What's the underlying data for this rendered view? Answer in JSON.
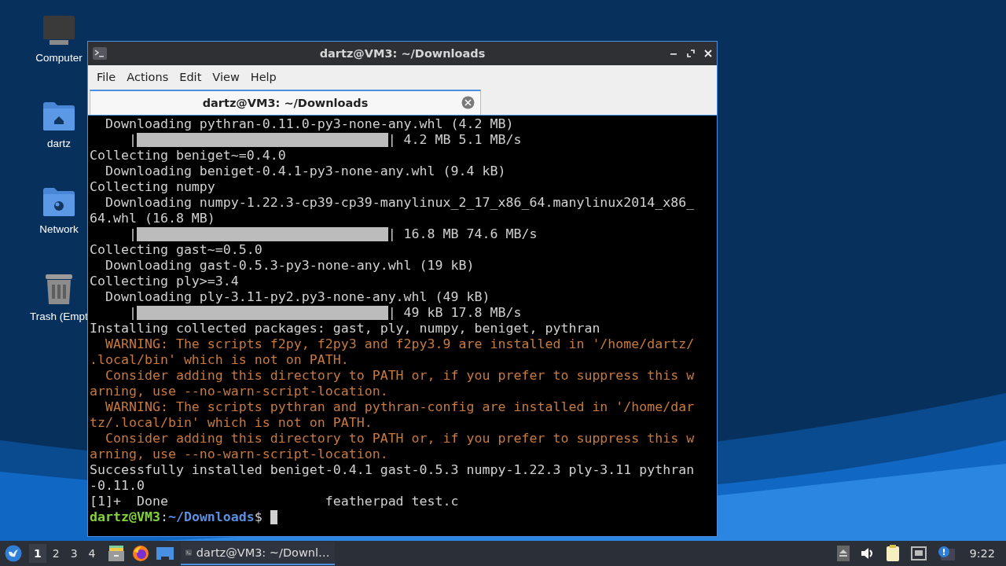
{
  "desktop": {
    "icons": [
      {
        "kind": "computer",
        "label": "Computer"
      },
      {
        "kind": "home",
        "label": "dartz"
      },
      {
        "kind": "network",
        "label": "Network"
      },
      {
        "kind": "trash",
        "label": "Trash (Empt"
      }
    ]
  },
  "window": {
    "title": "dartz@VM3: ~/Downloads",
    "menu": [
      "File",
      "Actions",
      "Edit",
      "View",
      "Help"
    ],
    "tabs": [
      {
        "label": "dartz@VM3: ~/Downloads",
        "selected": true
      }
    ],
    "terminal": {
      "lines": [
        {
          "kind": "normal",
          "text": "  Downloading pythran-0.11.0-py3-none-any.whl (4.2 MB)"
        },
        {
          "kind": "progress",
          "lead": "     |",
          "tail": "| 4.2 MB 5.1 MB/s",
          "level": 1
        },
        {
          "kind": "normal",
          "text": "Collecting beniget~=0.4.0"
        },
        {
          "kind": "normal",
          "text": "  Downloading beniget-0.4.1-py3-none-any.whl (9.4 kB)"
        },
        {
          "kind": "normal",
          "text": "Collecting numpy"
        },
        {
          "kind": "normal",
          "text": "  Downloading numpy-1.22.3-cp39-cp39-manylinux_2_17_x86_64.manylinux2014_x86_"
        },
        {
          "kind": "normal",
          "text": "64.whl (16.8 MB)"
        },
        {
          "kind": "progress",
          "lead": "     |",
          "tail": "| 16.8 MB 74.6 MB/s",
          "level": 1
        },
        {
          "kind": "normal",
          "text": "Collecting gast~=0.5.0"
        },
        {
          "kind": "normal",
          "text": "  Downloading gast-0.5.3-py3-none-any.whl (19 kB)"
        },
        {
          "kind": "normal",
          "text": "Collecting ply>=3.4"
        },
        {
          "kind": "normal",
          "text": "  Downloading ply-3.11-py2.py3-none-any.whl (49 kB)"
        },
        {
          "kind": "progress",
          "lead": "     |",
          "tail": "| 49 kB 17.8 MB/s",
          "level": 1
        },
        {
          "kind": "normal",
          "text": "Installing collected packages: gast, ply, numpy, beniget, pythran"
        },
        {
          "kind": "warning",
          "text": "  WARNING: The scripts f2py, f2py3 and f2py3.9 are installed in '/home/dartz/"
        },
        {
          "kind": "warning",
          "text": ".local/bin' which is not on PATH."
        },
        {
          "kind": "warning",
          "text": "  Consider adding this directory to PATH or, if you prefer to suppress this w"
        },
        {
          "kind": "warning",
          "text": "arning, use --no-warn-script-location."
        },
        {
          "kind": "warning",
          "text": "  WARNING: The scripts pythran and pythran-config are installed in '/home/dar"
        },
        {
          "kind": "warning",
          "text": "tz/.local/bin' which is not on PATH."
        },
        {
          "kind": "warning",
          "text": "  Consider adding this directory to PATH or, if you prefer to suppress this w"
        },
        {
          "kind": "warning",
          "text": "arning, use --no-warn-script-location."
        },
        {
          "kind": "normal",
          "text": "Successfully installed beniget-0.4.1 gast-0.5.3 numpy-1.22.3 ply-3.11 pythran"
        },
        {
          "kind": "normal",
          "text": "-0.11.0"
        },
        {
          "kind": "normal",
          "text": "[1]+  Done                    featherpad test.c"
        },
        {
          "kind": "prompt",
          "user": "dartz@VM3",
          "sep": ":",
          "path": "~/Downloads",
          "symbol": "$"
        }
      ]
    }
  },
  "taskbar": {
    "workspaces": [
      {
        "label": "1",
        "selected": true
      },
      {
        "label": "2",
        "selected": false
      },
      {
        "label": "3",
        "selected": false
      },
      {
        "label": "4",
        "selected": false
      }
    ],
    "launchers": [
      {
        "kind": "files"
      },
      {
        "kind": "browser"
      },
      {
        "kind": "desktop"
      }
    ],
    "tasks": [
      {
        "label": "dartz@VM3: ~/Downl…",
        "selected": true
      }
    ],
    "tray": [
      {
        "kind": "eject"
      },
      {
        "kind": "volume"
      },
      {
        "kind": "clipboard"
      },
      {
        "kind": "network"
      },
      {
        "kind": "notification"
      }
    ],
    "clock": "9:22"
  }
}
